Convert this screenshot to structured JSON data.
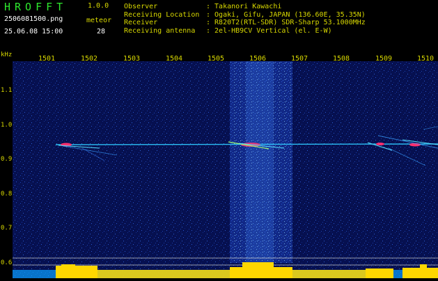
{
  "header": {
    "app_title": "HROFFT",
    "app_version": "1.0.0",
    "filename": "2506081500.png",
    "datetime": "25.06.08 15:00",
    "meteor_label": "meteor",
    "meteor_count": "28"
  },
  "info": [
    {
      "key": "Observer",
      "value": ": Takanori Kawachi"
    },
    {
      "key": "Receiving Location",
      "value": ": Ogaki, Gifu, JAPAN (136.60E, 35.35N)"
    },
    {
      "key": "Receiver",
      "value": ": R820T2(RTL-SDR) SDR-Sharp 53.1000MHz"
    },
    {
      "key": "Receiving antenna",
      "value": ": 2el-HB9CV Vertical (el. E-W)"
    }
  ],
  "axes": {
    "y_unit": "kHz",
    "x_ticks": [
      "1501",
      "1502",
      "1503",
      "1504",
      "1505",
      "1506",
      "1507",
      "1508",
      "1509",
      "1510"
    ],
    "y_ticks": [
      "1.1",
      "1.0",
      "0.9",
      "0.8",
      "0.7",
      "0.6"
    ]
  },
  "colors": {
    "background": "#000000",
    "noise": "#0a1a6a",
    "trace": "#2ec9ff",
    "echo": "#ff3070",
    "amplitude": "#ffd700",
    "label": "#d8d800",
    "title": "#2ee82e"
  }
}
